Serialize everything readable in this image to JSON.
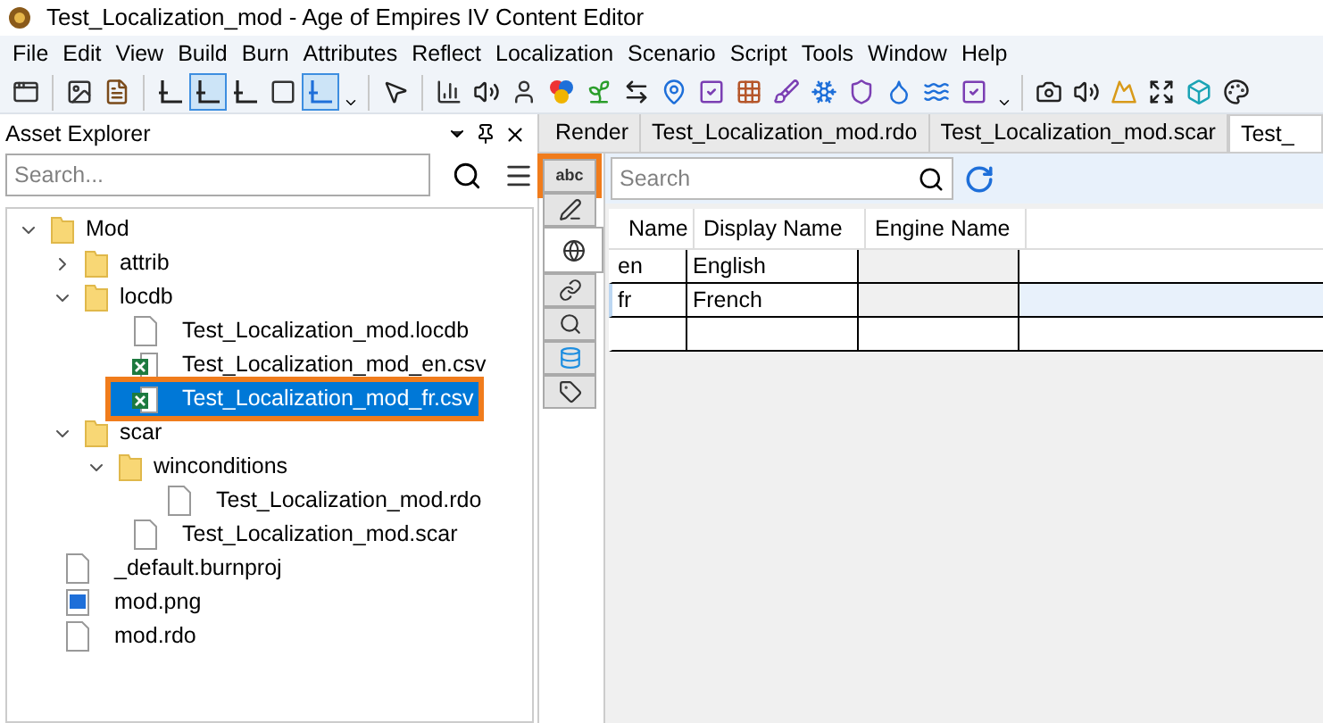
{
  "window": {
    "title": "Test_Localization_mod - Age of Empires IV Content Editor"
  },
  "menu": [
    "File",
    "Edit",
    "View",
    "Build",
    "Burn",
    "Attributes",
    "Reflect",
    "Localization",
    "Scenario",
    "Script",
    "Tools",
    "Window",
    "Help"
  ],
  "toolbar": [
    {
      "kind": "window",
      "pressed": false
    },
    {
      "kind": "sep"
    },
    {
      "kind": "image",
      "pressed": false
    },
    {
      "kind": "notes",
      "pressed": false
    },
    {
      "kind": "sep"
    },
    {
      "kind": "axis",
      "pressed": false
    },
    {
      "kind": "axis",
      "pressed": true
    },
    {
      "kind": "axis",
      "pressed": false
    },
    {
      "kind": "square",
      "pressed": false
    },
    {
      "kind": "corner",
      "pressed": true
    },
    {
      "kind": "more"
    },
    {
      "kind": "sep"
    },
    {
      "kind": "pointer",
      "pressed": false
    },
    {
      "kind": "sep"
    },
    {
      "kind": "chart",
      "pressed": false
    },
    {
      "kind": "sound",
      "pressed": false
    },
    {
      "kind": "person",
      "pressed": false
    },
    {
      "kind": "circles",
      "pressed": false
    },
    {
      "kind": "sprout",
      "pressed": false
    },
    {
      "kind": "swap",
      "pressed": false
    },
    {
      "kind": "pin",
      "pressed": false
    },
    {
      "kind": "check",
      "pressed": false
    },
    {
      "kind": "grid",
      "pressed": false
    },
    {
      "kind": "brush",
      "pressed": false
    },
    {
      "kind": "snow",
      "pressed": false
    },
    {
      "kind": "shield",
      "pressed": false
    },
    {
      "kind": "drop",
      "pressed": false
    },
    {
      "kind": "waves",
      "pressed": false
    },
    {
      "kind": "check",
      "pressed": false
    },
    {
      "kind": "more"
    },
    {
      "kind": "sep"
    },
    {
      "kind": "camera",
      "pressed": false
    },
    {
      "kind": "sound",
      "pressed": false
    },
    {
      "kind": "landscape",
      "pressed": false
    },
    {
      "kind": "expand",
      "pressed": false
    },
    {
      "kind": "cube",
      "pressed": false
    },
    {
      "kind": "palette",
      "pressed": false
    }
  ],
  "asset_explorer": {
    "title": "Asset Explorer",
    "search": {
      "placeholder": "Search..."
    },
    "tree": [
      {
        "label": "Mod",
        "kind": "folder",
        "expanded": true,
        "selected": false,
        "children": [
          {
            "label": "attrib",
            "kind": "folder",
            "expanded": false,
            "selected": false
          },
          {
            "label": "locdb",
            "kind": "folder",
            "expanded": true,
            "selected": false,
            "children": [
              {
                "label": "Test_Localization_mod.locdb",
                "kind": "file",
                "selected": false
              },
              {
                "label": "Test_Localization_mod_en.csv",
                "kind": "csv",
                "selected": false
              },
              {
                "label": "Test_Localization_mod_fr.csv",
                "kind": "csv",
                "selected": true
              }
            ]
          },
          {
            "label": "scar",
            "kind": "folder",
            "expanded": true,
            "selected": false,
            "children": [
              {
                "label": "winconditions",
                "kind": "folder",
                "expanded": true,
                "selected": false,
                "children": [
                  {
                    "label": "Test_Localization_mod.rdo",
                    "kind": "file",
                    "selected": false
                  }
                ]
              },
              {
                "label": "Test_Localization_mod.scar",
                "kind": "file",
                "selected": false
              }
            ]
          }
        ]
      },
      {
        "label": "_default.burnproj",
        "kind": "file",
        "selected": false
      },
      {
        "label": "mod.png",
        "kind": "image",
        "selected": false
      },
      {
        "label": "mod.rdo",
        "kind": "file",
        "selected": false
      }
    ]
  },
  "tabs": [
    {
      "label": "Render",
      "selected": false
    },
    {
      "label": "Test_Localization_mod.rdo",
      "selected": false
    },
    {
      "label": "Test_Localization_mod.scar",
      "selected": false
    },
    {
      "label": "Test_",
      "selected": true
    }
  ],
  "side_tabs": [
    {
      "kind": "text",
      "label": "abc",
      "selected": false,
      "highlighted": true
    },
    {
      "kind": "edit",
      "selected": false,
      "highlighted": false
    },
    {
      "kind": "globe",
      "selected": true,
      "highlighted": false
    },
    {
      "kind": "link",
      "selected": false,
      "highlighted": false
    },
    {
      "kind": "search",
      "selected": false,
      "highlighted": false
    },
    {
      "kind": "database",
      "selected": false,
      "highlighted": false
    },
    {
      "kind": "tag",
      "selected": false,
      "highlighted": false
    }
  ],
  "editor": {
    "search": {
      "placeholder": "Search"
    },
    "table": {
      "columns": [
        "Name",
        "Display Name",
        "Engine Name"
      ],
      "rows": [
        {
          "cells": [
            "en",
            "English",
            ""
          ],
          "selected": false
        },
        {
          "cells": [
            "fr",
            "French",
            ""
          ],
          "selected": true
        }
      ]
    }
  }
}
